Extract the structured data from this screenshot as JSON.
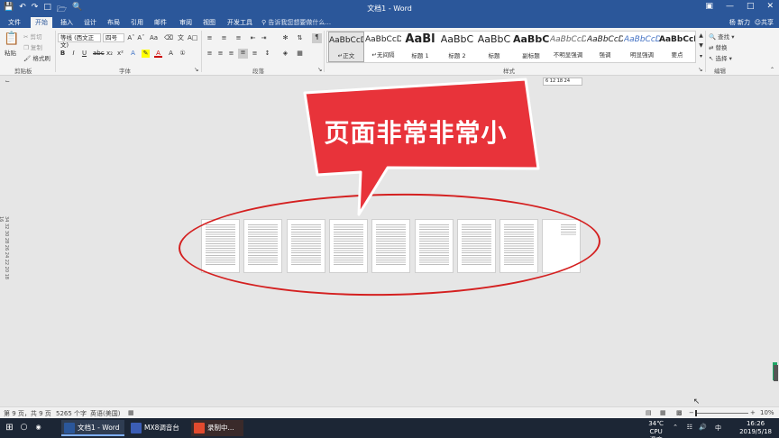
{
  "window": {
    "title": "文档1 - Word",
    "accent_color": "#2b579a"
  },
  "menu": {
    "file": "文件",
    "tabs": [
      "开始",
      "插入",
      "设计",
      "布局",
      "引用",
      "邮件",
      "审阅",
      "视图",
      "开发工具"
    ],
    "active_tab": "开始",
    "tell_me": "告诉我您想要做什么...",
    "user": "杨 新力",
    "share": "共享"
  },
  "ribbon": {
    "clipboard": {
      "label": "剪贴板",
      "paste": "粘贴",
      "cut": "剪切",
      "copy": "复制",
      "format_painter": "格式刷"
    },
    "font": {
      "label": "字体",
      "font_name": "等线 (西文正文)",
      "font_size": "四号"
    },
    "paragraph": {
      "label": "段落"
    },
    "styles": {
      "label": "样式",
      "items": [
        {
          "preview": "AaBbCcDd",
          "name": "正文"
        },
        {
          "preview": "AaBbCcDd",
          "name": "无间隔"
        },
        {
          "preview": "AaBl",
          "name": "标题 1"
        },
        {
          "preview": "AaBbC",
          "name": "标题 2"
        },
        {
          "preview": "AaBbC",
          "name": "标题"
        },
        {
          "preview": "AaBbC",
          "name": "副标题"
        },
        {
          "preview": "AaBbCcDd",
          "name": "不明显强调"
        },
        {
          "preview": "AaBbCcDd",
          "name": "强调"
        },
        {
          "preview": "AaBbCcDd",
          "name": "明显强调"
        },
        {
          "preview": "AaBbCcDd",
          "name": "要点"
        }
      ]
    },
    "editing": {
      "label": "编辑",
      "find": "查找",
      "replace": "替换",
      "select": "选择"
    }
  },
  "ruler_box": "6 12 18 24",
  "left_ruler": "34 32 30 28 26 24 22 20 18 16",
  "annotation": {
    "callout_text": "页面非常非常小",
    "color": "#e8333a"
  },
  "pages": {
    "count": 9
  },
  "status": {
    "page": "第 9 页，共 9 页",
    "words": "5265 个字",
    "language": "英语(美国)",
    "zoom": "10%"
  },
  "taskbar": {
    "items": [
      "文档1 - Word",
      "MX8调音台",
      "录制中..."
    ],
    "temperature": "34℃",
    "cpu_label": "CPU温度",
    "time": "16:26",
    "date": "2019/5/18"
  }
}
